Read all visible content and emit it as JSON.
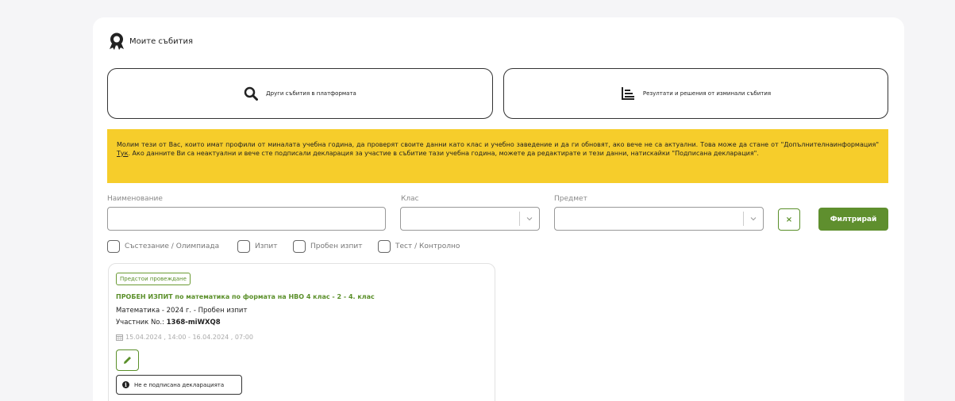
{
  "header": {
    "title": "Моите събития"
  },
  "actions": {
    "other_events": "Други събития в платформата",
    "results": "Резултати и решения от изминали събития"
  },
  "notice": {
    "text_before_link": "Молим тези от Вас, които имат профили от миналата учебна година, да проверят своите данни като клас и учебно заведение и да ги обновят, ако вече не са актуални. Това може да стане от \"Допълнителнаинформация\" ",
    "link": "Тук",
    "text_after_link": ". Ако данните Ви са неактуални и вече сте подписали декларация за участие в събитие тази учебна година, можете да редактирате и тези данни, натискайки \"Подписана декларация\"."
  },
  "filters": {
    "name_label": "Наименование",
    "name_value": "",
    "class_label": "Клас",
    "class_value": "",
    "subject_label": "Предмет",
    "subject_value": "",
    "clear_symbol": "×",
    "filter_button": "Филтрирай",
    "types": [
      {
        "label": "Състезание / Олимпиада",
        "checked": false
      },
      {
        "label": "Изпит",
        "checked": false
      },
      {
        "label": "Пробен изпит",
        "checked": false
      },
      {
        "label": "Тест / Контролно",
        "checked": false
      }
    ]
  },
  "event": {
    "status": "Предстои провеждане",
    "title": "ПРОБЕН ИЗПИТ по математика по формата на НВО 4 клас - 2 - 4. клас",
    "subtitle": "Математика - 2024 г. - Пробен изпит",
    "participant_label": "Участник No.: ",
    "participant_id": "1368-miWXQ8",
    "dates": "15.04.2024 , 14:00 - 16.04.2024 , 07:00",
    "declaration": "Не е подписана декларацията",
    "info_symbol": "i"
  },
  "colors": {
    "accent": "#5f8f2e",
    "notice": "#f6cd2b",
    "page": "#f5f5f7"
  }
}
